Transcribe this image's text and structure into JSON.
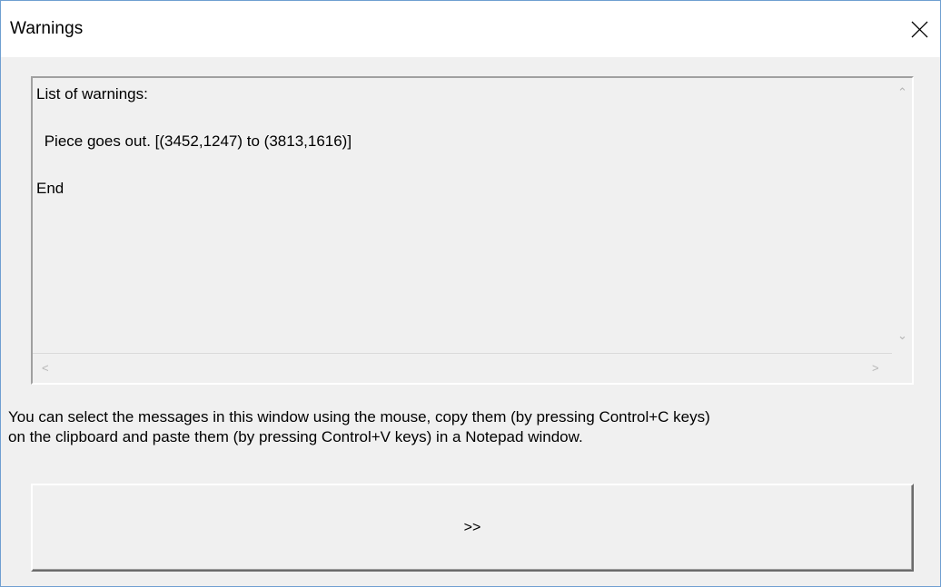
{
  "window": {
    "title": "Warnings",
    "close_icon": "close-icon"
  },
  "warnings_panel": {
    "lines": [
      "List of warnings:",
      " Piece goes out. [(3452,1247) to (3813,1616)]",
      "End"
    ],
    "scroll_icons": [
      "chevron-up-icon",
      "chevron-down-icon",
      "chevron-left-icon",
      "chevron-right-icon"
    ]
  },
  "info_text": {
    "line1": "You can select the messages in this window using the mouse, copy  them (by pressing Control+C keys)",
    "line2": "on the clipboard and paste them (by pressing Control+V keys) in a Notepad window."
  },
  "next_button": {
    "label": ">>"
  },
  "colors": {
    "window_border": "#6f9fd1",
    "dialog_background": "#f0f0f0",
    "title_background": "#ffffff"
  }
}
